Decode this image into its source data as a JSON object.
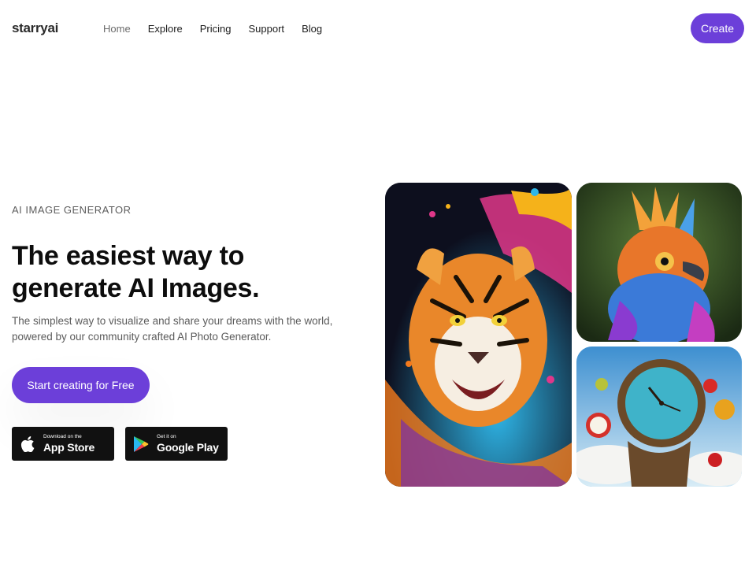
{
  "header": {
    "logo": "starryai",
    "nav": [
      "Home",
      "Explore",
      "Pricing",
      "Support",
      "Blog"
    ],
    "create_label": "Create"
  },
  "hero": {
    "eyebrow": "AI IMAGE GENERATOR",
    "headline_line1": "The easiest way to",
    "headline_line2": "generate AI Images.",
    "subtext": "The simplest way to visualize and share your dreams with the world, powered by our community crafted AI Photo Generator.",
    "cta_label": "Start creating for Free"
  },
  "stores": {
    "apple_small": "Download on the",
    "apple_big": "App Store",
    "google_small": "Get it on",
    "google_big": "Google Play"
  },
  "colors": {
    "accent": "#6c3fd9",
    "store_bg": "#111111"
  }
}
